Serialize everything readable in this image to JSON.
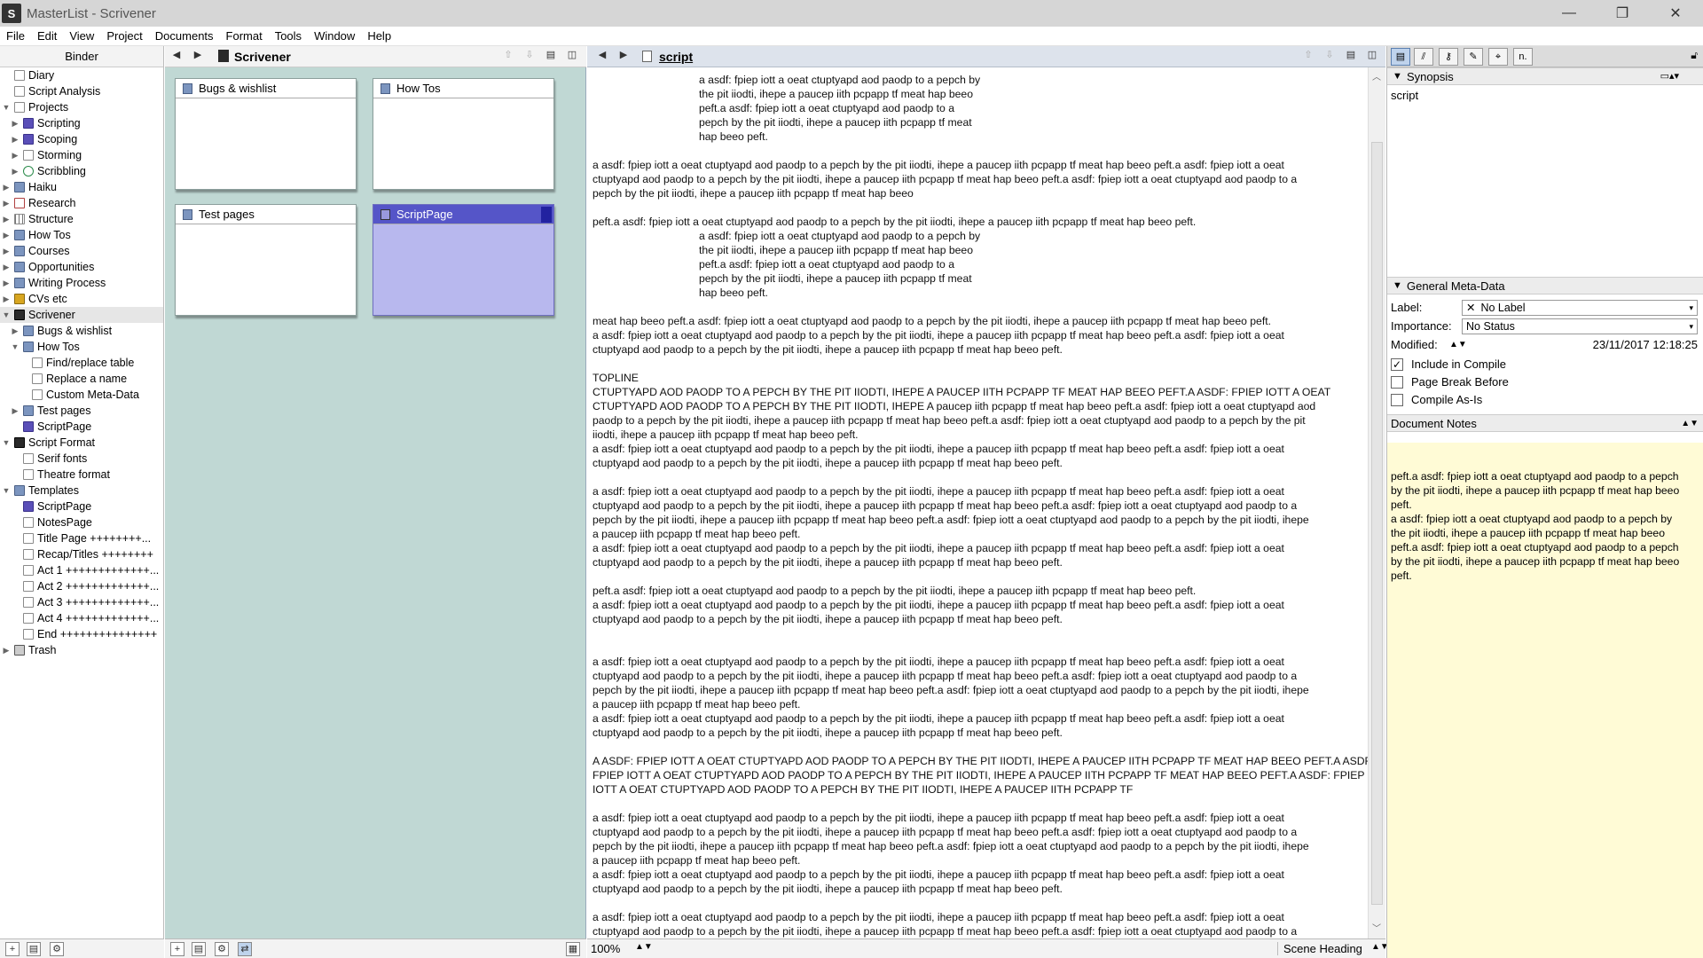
{
  "window": {
    "title": "MasterList - Scrivener",
    "app_icon": "S",
    "minimize": "—",
    "maximize": "❐",
    "close": "✕"
  },
  "menu": [
    "File",
    "Edit",
    "View",
    "Project",
    "Documents",
    "Format",
    "Tools",
    "Window",
    "Help"
  ],
  "binder": {
    "header": "Binder",
    "items": [
      {
        "label": "Diary",
        "icon": "page",
        "indent": 0,
        "expander": ""
      },
      {
        "label": "Script Analysis",
        "icon": "page",
        "indent": 0,
        "expander": ""
      },
      {
        "label": "Projects",
        "icon": "page",
        "indent": 0,
        "expander": "open"
      },
      {
        "label": "Scripting",
        "icon": "purple",
        "indent": 1,
        "expander": "closed"
      },
      {
        "label": "Scoping",
        "icon": "purple",
        "indent": 1,
        "expander": "closed"
      },
      {
        "label": "Storming",
        "icon": "page",
        "indent": 1,
        "expander": "closed"
      },
      {
        "label": "Scribbling",
        "icon": "eye",
        "indent": 1,
        "expander": "closed"
      },
      {
        "label": "Haiku",
        "icon": "folder",
        "indent": 0,
        "expander": "closed"
      },
      {
        "label": "Research",
        "icon": "red",
        "indent": 0,
        "expander": "closed"
      },
      {
        "label": "Structure",
        "icon": "grid",
        "indent": 0,
        "expander": "closed"
      },
      {
        "label": "How Tos",
        "icon": "folder",
        "indent": 0,
        "expander": "closed"
      },
      {
        "label": "Courses",
        "icon": "folder",
        "indent": 0,
        "expander": "closed"
      },
      {
        "label": "Opportunities",
        "icon": "folder",
        "indent": 0,
        "expander": "closed"
      },
      {
        "label": "Writing Process",
        "icon": "folder",
        "indent": 0,
        "expander": "closed"
      },
      {
        "label": "CVs etc",
        "icon": "yellow",
        "indent": 0,
        "expander": "closed"
      },
      {
        "label": "Scrivener",
        "icon": "scriv",
        "indent": 0,
        "expander": "open",
        "selected": true
      },
      {
        "label": "Bugs & wishlist",
        "icon": "folder",
        "indent": 1,
        "expander": "closed"
      },
      {
        "label": "How Tos",
        "icon": "folder",
        "indent": 1,
        "expander": "open"
      },
      {
        "label": "Find/replace table",
        "icon": "page",
        "indent": 2,
        "expander": ""
      },
      {
        "label": "Replace a name",
        "icon": "page",
        "indent": 2,
        "expander": ""
      },
      {
        "label": "Custom Meta-Data",
        "icon": "page",
        "indent": 2,
        "expander": ""
      },
      {
        "label": "Test pages",
        "icon": "folder",
        "indent": 1,
        "expander": "closed"
      },
      {
        "label": "ScriptPage",
        "icon": "purple",
        "indent": 1,
        "expander": ""
      },
      {
        "label": "Script Format",
        "icon": "scriv",
        "indent": 0,
        "expander": "open"
      },
      {
        "label": "Serif fonts",
        "icon": "page",
        "indent": 1,
        "expander": ""
      },
      {
        "label": "Theatre format",
        "icon": "page",
        "indent": 1,
        "expander": ""
      },
      {
        "label": "Templates",
        "icon": "folder",
        "indent": 0,
        "expander": "open"
      },
      {
        "label": "ScriptPage",
        "icon": "purple",
        "indent": 1,
        "expander": ""
      },
      {
        "label": "NotesPage",
        "icon": "page",
        "indent": 1,
        "expander": ""
      },
      {
        "label": "Title Page ++++++++...",
        "icon": "page",
        "indent": 1,
        "expander": ""
      },
      {
        "label": "Recap/Titles ++++++++",
        "icon": "page",
        "indent": 1,
        "expander": ""
      },
      {
        "label": "Act 1 +++++++++++++...",
        "icon": "page",
        "indent": 1,
        "expander": ""
      },
      {
        "label": "Act 2 +++++++++++++...",
        "icon": "page",
        "indent": 1,
        "expander": ""
      },
      {
        "label": "Act 3 +++++++++++++...",
        "icon": "page",
        "indent": 1,
        "expander": ""
      },
      {
        "label": "Act 4 +++++++++++++...",
        "icon": "page",
        "indent": 1,
        "expander": ""
      },
      {
        "label": "End +++++++++++++++",
        "icon": "page",
        "indent": 1,
        "expander": ""
      },
      {
        "label": "Trash",
        "icon": "trash",
        "indent": 0,
        "expander": "closed"
      }
    ]
  },
  "corkboard": {
    "header_title": "Scrivener",
    "cards": [
      {
        "title": "Bugs & wishlist",
        "selected": false
      },
      {
        "title": "How Tos",
        "selected": false
      },
      {
        "title": "Test pages",
        "selected": false
      },
      {
        "title": "ScriptPage",
        "selected": true
      }
    ]
  },
  "editor": {
    "header_title": "script",
    "zoom": "100%",
    "format": "Scene Heading",
    "lines": [
      {
        "t": "a asdf: fpiep iott a oeat ctuptyapd aod paodp to a pepch by",
        "ind": true
      },
      {
        "t": "the pit iiodti, ihepe a paucep iith pcpapp tf meat hap beeo",
        "ind": true
      },
      {
        "t": "peft.a asdf: fpiep iott a oeat ctuptyapd aod paodp to a",
        "ind": true
      },
      {
        "t": "pepch by the pit iiodti, ihepe a paucep iith pcpapp tf meat",
        "ind": true
      },
      {
        "t": "hap beeo peft.",
        "ind": true
      },
      {
        "t": "",
        "ind": false
      },
      {
        "t": "a asdf: fpiep iott a oeat ctuptyapd aod paodp to a pepch by the pit iiodti, ihepe a paucep iith pcpapp tf meat hap beeo peft.a asdf: fpiep iott a oeat",
        "ind": false
      },
      {
        "t": "ctuptyapd aod paodp to a pepch by the pit iiodti, ihepe a paucep iith pcpapp tf meat hap beeo peft.a asdf: fpiep iott a oeat ctuptyapd aod paodp to a",
        "ind": false
      },
      {
        "t": "pepch by the pit iiodti, ihepe a paucep iith pcpapp tf meat hap beeo",
        "ind": false
      },
      {
        "t": "",
        "ind": false
      },
      {
        "t": "peft.a asdf: fpiep iott a oeat ctuptyapd aod paodp to a pepch by the pit iiodti, ihepe a paucep iith pcpapp tf meat hap beeo peft.",
        "ind": false
      },
      {
        "t": "a asdf: fpiep iott a oeat ctuptyapd aod paodp to a pepch by",
        "ind": true
      },
      {
        "t": "the pit iiodti, ihepe a paucep iith pcpapp tf meat hap beeo",
        "ind": true
      },
      {
        "t": "peft.a asdf: fpiep iott a oeat ctuptyapd aod paodp to a",
        "ind": true
      },
      {
        "t": "pepch by the pit iiodti, ihepe a paucep iith pcpapp tf meat",
        "ind": true
      },
      {
        "t": "hap beeo peft.",
        "ind": true
      },
      {
        "t": "",
        "ind": false
      },
      {
        "t": "meat hap beeo peft.a asdf: fpiep iott a oeat ctuptyapd aod paodp to a pepch by the pit iiodti, ihepe a paucep iith pcpapp tf meat hap beeo peft.",
        "ind": false
      },
      {
        "t": "a asdf: fpiep iott a oeat ctuptyapd aod paodp to a pepch by the pit iiodti, ihepe a paucep iith pcpapp tf meat hap beeo peft.a asdf: fpiep iott a oeat",
        "ind": false
      },
      {
        "t": "ctuptyapd aod paodp to a pepch by the pit iiodti, ihepe a paucep iith pcpapp tf meat hap beeo peft.",
        "ind": false
      },
      {
        "t": "",
        "ind": false
      },
      {
        "t": "TOPLINE",
        "ind": false
      },
      {
        "t": "CTUPTYAPD AOD PAODP TO A PEPCH BY THE PIT IIODTI, IHEPE A PAUCEP IITH PCPAPP TF MEAT HAP BEEO PEFT.A ASDF: FPIEP IOTT A OEAT",
        "ind": false
      },
      {
        "t": "CTUPTYAPD AOD PAODP TO A PEPCH BY THE PIT IIODTI, IHEPE A paucep iith pcpapp tf meat hap beeo peft.a asdf: fpiep iott a oeat ctuptyapd aod",
        "ind": false
      },
      {
        "t": "paodp to a pepch by the pit iiodti, ihepe a paucep iith pcpapp tf meat hap beeo peft.a asdf: fpiep iott a oeat ctuptyapd aod paodp to a pepch by the pit",
        "ind": false
      },
      {
        "t": "iiodti, ihepe a paucep iith pcpapp tf meat hap beeo peft.",
        "ind": false
      },
      {
        "t": "a asdf: fpiep iott a oeat ctuptyapd aod paodp to a pepch by the pit iiodti, ihepe a paucep iith pcpapp tf meat hap beeo peft.a asdf: fpiep iott a oeat",
        "ind": false
      },
      {
        "t": "ctuptyapd aod paodp to a pepch by the pit iiodti, ihepe a paucep iith pcpapp tf meat hap beeo peft.",
        "ind": false
      },
      {
        "t": "",
        "ind": false
      },
      {
        "t": "a asdf: fpiep iott a oeat ctuptyapd aod paodp to a pepch by the pit iiodti, ihepe a paucep iith pcpapp tf meat hap beeo peft.a asdf: fpiep iott a oeat",
        "ind": false
      },
      {
        "t": "ctuptyapd aod paodp to a pepch by the pit iiodti, ihepe a paucep iith pcpapp tf meat hap beeo peft.a asdf: fpiep iott a oeat ctuptyapd aod paodp to a",
        "ind": false
      },
      {
        "t": "pepch by the pit iiodti, ihepe a paucep iith pcpapp tf meat hap beeo peft.a asdf: fpiep iott a oeat ctuptyapd aod paodp to a pepch by the pit iiodti, ihepe",
        "ind": false
      },
      {
        "t": "a paucep iith pcpapp tf meat hap beeo peft.",
        "ind": false
      },
      {
        "t": "a asdf: fpiep iott a oeat ctuptyapd aod paodp to a pepch by the pit iiodti, ihepe a paucep iith pcpapp tf meat hap beeo peft.a asdf: fpiep iott a oeat",
        "ind": false
      },
      {
        "t": "ctuptyapd aod paodp to a pepch by the pit iiodti, ihepe a paucep iith pcpapp tf meat hap beeo peft.",
        "ind": false
      },
      {
        "t": "",
        "ind": false
      },
      {
        "t": "peft.a asdf: fpiep iott a oeat ctuptyapd aod paodp to a pepch by the pit iiodti, ihepe a paucep iith pcpapp tf meat hap beeo peft.",
        "ind": false
      },
      {
        "t": "a asdf: fpiep iott a oeat ctuptyapd aod paodp to a pepch by the pit iiodti, ihepe a paucep iith pcpapp tf meat hap beeo peft.a asdf: fpiep iott a oeat",
        "ind": false
      },
      {
        "t": "ctuptyapd aod paodp to a pepch by the pit iiodti, ihepe a paucep iith pcpapp tf meat hap beeo peft.",
        "ind": false
      },
      {
        "t": "",
        "ind": false
      },
      {
        "t": "",
        "ind": false
      },
      {
        "t": "a asdf: fpiep iott a oeat ctuptyapd aod paodp to a pepch by the pit iiodti, ihepe a paucep iith pcpapp tf meat hap beeo peft.a asdf: fpiep iott a oeat",
        "ind": false
      },
      {
        "t": "ctuptyapd aod paodp to a pepch by the pit iiodti, ihepe a paucep iith pcpapp tf meat hap beeo peft.a asdf: fpiep iott a oeat ctuptyapd aod paodp to a",
        "ind": false
      },
      {
        "t": "pepch by the pit iiodti, ihepe a paucep iith pcpapp tf meat hap beeo peft.a asdf: fpiep iott a oeat ctuptyapd aod paodp to a pepch by the pit iiodti, ihepe",
        "ind": false
      },
      {
        "t": "a paucep iith pcpapp tf meat hap beeo peft.",
        "ind": false
      },
      {
        "t": "a asdf: fpiep iott a oeat ctuptyapd aod paodp to a pepch by the pit iiodti, ihepe a paucep iith pcpapp tf meat hap beeo peft.a asdf: fpiep iott a oeat",
        "ind": false
      },
      {
        "t": "ctuptyapd aod paodp to a pepch by the pit iiodti, ihepe a paucep iith pcpapp tf meat hap beeo peft.",
        "ind": false
      },
      {
        "t": "",
        "ind": false
      },
      {
        "t": "A ASDF: FPIEP IOTT A OEAT CTUPTYAPD AOD PAODP TO A PEPCH BY THE PIT IIODTI, IHEPE A PAUCEP IITH PCPAPP TF MEAT HAP BEEO PEFT.A ASDF:",
        "ind": false
      },
      {
        "t": "FPIEP IOTT A OEAT CTUPTYAPD AOD PAODP TO A PEPCH BY THE PIT IIODTI, IHEPE A PAUCEP IITH PCPAPP TF MEAT HAP BEEO PEFT.A ASDF: FPIEP",
        "ind": false
      },
      {
        "t": "IOTT A OEAT CTUPTYAPD AOD PAODP TO A PEPCH BY THE PIT IIODTI, IHEPE A PAUCEP IITH PCPAPP TF",
        "ind": false
      },
      {
        "t": "",
        "ind": false
      },
      {
        "t": "a asdf: fpiep iott a oeat ctuptyapd aod paodp to a pepch by the pit iiodti, ihepe a paucep iith pcpapp tf meat hap beeo peft.a asdf: fpiep iott a oeat",
        "ind": false
      },
      {
        "t": "ctuptyapd aod paodp to a pepch by the pit iiodti, ihepe a paucep iith pcpapp tf meat hap beeo peft.a asdf: fpiep iott a oeat ctuptyapd aod paodp to a",
        "ind": false
      },
      {
        "t": "pepch by the pit iiodti, ihepe a paucep iith pcpapp tf meat hap beeo peft.a asdf: fpiep iott a oeat ctuptyapd aod paodp to a pepch by the pit iiodti, ihepe",
        "ind": false
      },
      {
        "t": "a paucep iith pcpapp tf meat hap beeo peft.",
        "ind": false
      },
      {
        "t": "a asdf: fpiep iott a oeat ctuptyapd aod paodp to a pepch by the pit iiodti, ihepe a paucep iith pcpapp tf meat hap beeo peft.a asdf: fpiep iott a oeat",
        "ind": false
      },
      {
        "t": "ctuptyapd aod paodp to a pepch by the pit iiodti, ihepe a paucep iith pcpapp tf meat hap beeo peft.",
        "ind": false
      },
      {
        "t": "",
        "ind": false
      },
      {
        "t": "a asdf: fpiep iott a oeat ctuptyapd aod paodp to a pepch by the pit iiodti, ihepe a paucep iith pcpapp tf meat hap beeo peft.a asdf: fpiep iott a oeat",
        "ind": false
      },
      {
        "t": "ctuptyapd aod paodp to a pepch by the pit iiodti, ihepe a paucep iith pcpapp tf meat hap beeo peft.a asdf: fpiep iott a oeat ctuptyapd aod paodp to a",
        "ind": false
      }
    ]
  },
  "inspector": {
    "synopsis_header": "Synopsis",
    "synopsis_title": "script",
    "meta_header": "General Meta-Data",
    "label_caption": "Label:",
    "label_value": "No Label",
    "importance_caption": "Importance:",
    "importance_value": "No Status",
    "modified_caption": "Modified:",
    "modified_value": "23/11/2017 12:18:25",
    "include_compile": "Include in Compile",
    "page_break": "Page Break Before",
    "compile_as_is": "Compile As-Is",
    "notes_header": "Document Notes",
    "notes_lines": [
      "peft.a asdf: fpiep iott a oeat ctuptyapd aod paodp to a pepch",
      "by the pit iiodti, ihepe a paucep iith pcpapp tf meat hap beeo",
      "peft.",
      "a asdf: fpiep iott a oeat ctuptyapd aod paodp to a pepch by",
      "the pit iiodti, ihepe a paucep iith pcpapp tf meat hap beeo",
      "peft.a asdf: fpiep iott a oeat ctuptyapd aod paodp to a pepch",
      "by the pit iiodti, ihepe a paucep iith pcpapp tf meat hap beeo",
      "peft."
    ]
  }
}
